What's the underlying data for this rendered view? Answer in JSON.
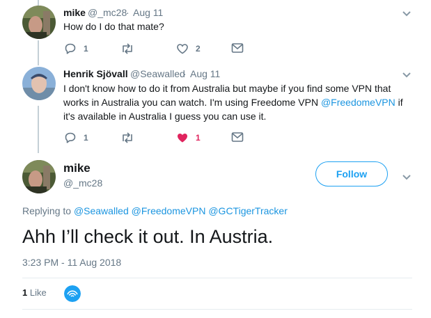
{
  "reply1": {
    "name": "mike",
    "handle": "@_mc28",
    "sep": "·",
    "date": "Aug 11",
    "text": "How do I do that mate?",
    "reply_count": "1",
    "retweet_count": "",
    "like_count": "2"
  },
  "reply2": {
    "name": "Henrik Sjövall",
    "handle": "@Seawalled",
    "sep": "·",
    "date": "Aug 11",
    "text_before": "I don't know how to do it from Australia but maybe if you find some VPN that works in Australia you can watch. I'm using Freedome VPN ",
    "mention": "@FreedomeVPN",
    "text_after": " if it's available in Australia I guess you can use it.",
    "reply_count": "1",
    "retweet_count": "",
    "like_count": "1",
    "liked": true
  },
  "main_tweet": {
    "name": "mike",
    "handle": "@_mc28",
    "follow_label": "Follow",
    "replying_to_label": "Replying to",
    "replying_to": [
      "@Seawalled",
      "@FreedomeVPN",
      "@GCTigerTracker"
    ],
    "text": "Ahh I’ll check it out. In Austria.",
    "timestamp": "3:23 PM - 11 Aug 2018",
    "like_count": "1",
    "like_label": "Like"
  },
  "colors": {
    "accent": "#1da1f2",
    "link": "#1b95e0",
    "muted": "#657786",
    "liked_heart": "#e0245e",
    "thread_line": "#c4cfd6"
  }
}
